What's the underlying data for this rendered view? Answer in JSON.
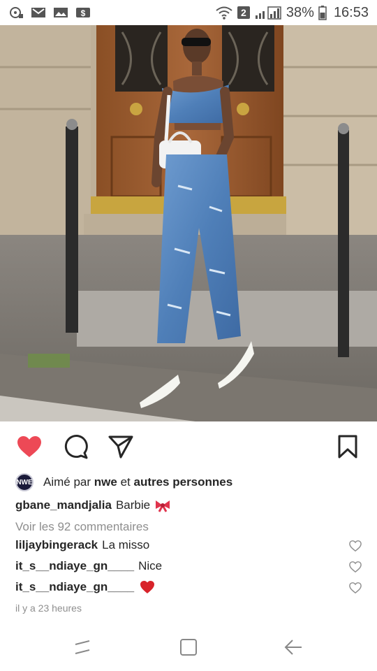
{
  "status_bar": {
    "sim_badge": "2",
    "battery": "38%",
    "time": "16:53"
  },
  "post": {
    "liked_by_prefix": "Aimé par",
    "liked_by_user": "nwe",
    "liked_by_join": "et",
    "liked_by_rest": "autres personnes",
    "avatar_label": "NWE",
    "caption_user": "gbane_mandjalia",
    "caption_text": "Barbie",
    "view_comments": "Voir les 92 commentaires",
    "comments": [
      {
        "user": "liljaybingerack",
        "text": "La misso"
      },
      {
        "user": "it_s__ndiaye_gn____",
        "text": "Nice"
      },
      {
        "user": "it_s__ndiaye_gn____",
        "text": ""
      }
    ],
    "timestamp": "il y a 23 heures"
  },
  "colors": {
    "like_red": "#ed4956",
    "text": "#262626",
    "muted": "#8e8e8e"
  },
  "icons": {
    "like": "heart-icon",
    "comment": "comment-icon",
    "share": "send-icon",
    "save": "bookmark-icon"
  }
}
